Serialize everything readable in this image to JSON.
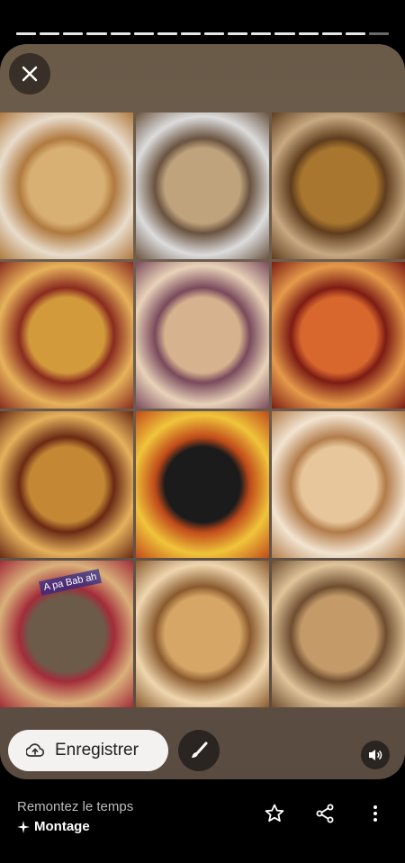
{
  "progress": {
    "segments": 16,
    "viewed": 15
  },
  "card": {
    "close_icon": "close-icon",
    "tiles": [
      {
        "name": "pizza-photo-1",
        "colors": [
          "#d9b074",
          "#b07a3f",
          "#e8dccb"
        ]
      },
      {
        "name": "pizza-photo-2",
        "colors": [
          "#bfa37c",
          "#6a5340",
          "#dcdcdc"
        ]
      },
      {
        "name": "pizza-photo-3",
        "colors": [
          "#a8762e",
          "#5f3d1d",
          "#c7a982"
        ]
      },
      {
        "name": "pizza-photo-4",
        "colors": [
          "#d39a3c",
          "#8a2b1f",
          "#e6b25a"
        ]
      },
      {
        "name": "pizza-photo-5",
        "colors": [
          "#d6b28e",
          "#7a4a5c",
          "#e8d2b8"
        ]
      },
      {
        "name": "pizza-photo-6",
        "colors": [
          "#d8672d",
          "#7d1c14",
          "#e59a4a"
        ]
      },
      {
        "name": "pizza-photo-7",
        "colors": [
          "#c48734",
          "#6a2a14",
          "#e5b15c"
        ]
      },
      {
        "name": "pizzeria-flyer",
        "colors": [
          "#1b1b1b",
          "#c04a1a",
          "#f0c43a"
        ]
      },
      {
        "name": "pizza-photo-9",
        "colors": [
          "#e6c69a",
          "#b27c4a",
          "#f2e4d0"
        ]
      },
      {
        "name": "pizza-photo-10",
        "colors": [
          "#6d5b4a",
          "#a32c3a",
          "#d9b07a"
        ]
      },
      {
        "name": "pizza-photo-11",
        "colors": [
          "#d5a665",
          "#8a5a2e",
          "#efd6ae"
        ]
      },
      {
        "name": "pizza-photo-12",
        "colors": [
          "#c39a68",
          "#6f4e30",
          "#e0c49a"
        ]
      }
    ],
    "caption_on_tile_10": "A pa Bab ah",
    "save_label": "Enregistrer"
  },
  "footer": {
    "title": "Remontez le temps",
    "subtitle": "Montage"
  }
}
